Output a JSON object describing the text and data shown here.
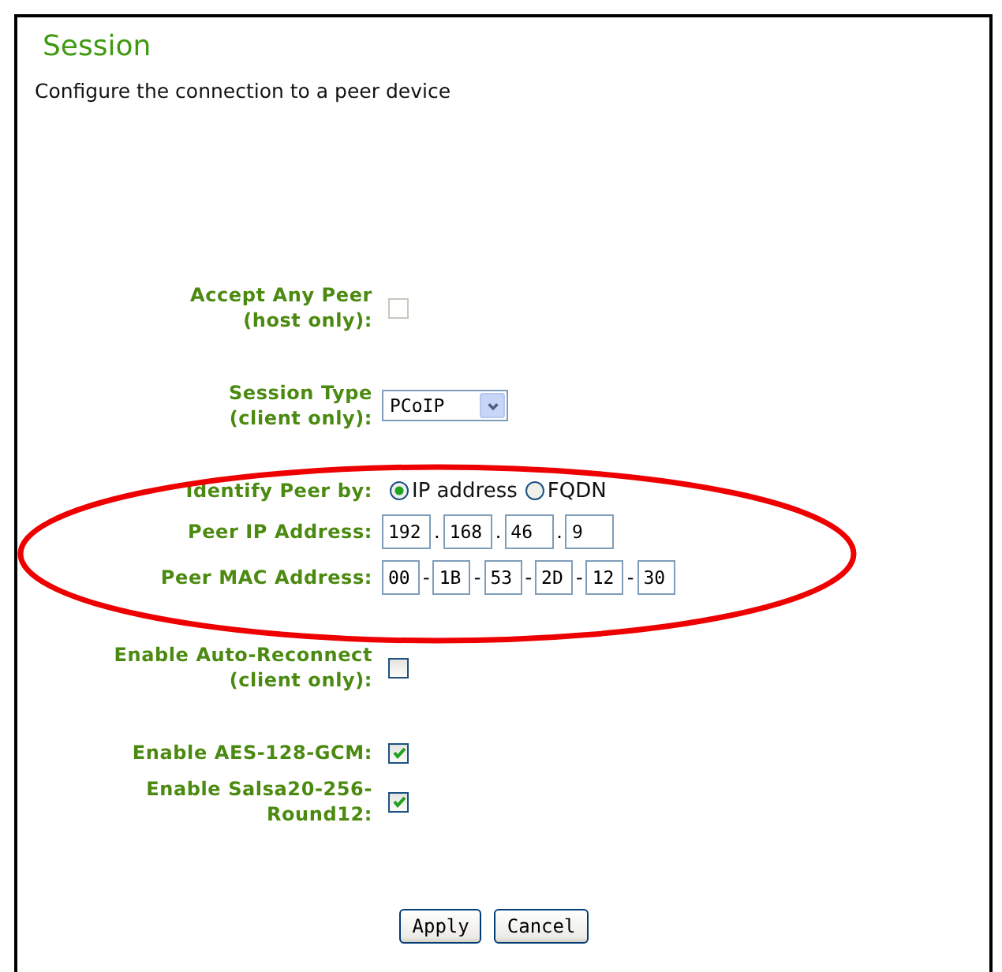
{
  "title": "Session",
  "description": "Configure the connection to a peer device",
  "groups": [
    {
      "rows": [
        {
          "kind": "checkbox",
          "label": [
            "Accept Any Peer",
            "(host only):"
          ],
          "checked": false,
          "disabled": true
        }
      ]
    },
    {
      "rows": [
        {
          "kind": "select",
          "label": [
            "Session Type",
            "(client only):"
          ],
          "value": "PCoIP"
        }
      ]
    },
    {
      "rows": [
        {
          "kind": "radio",
          "label": [
            "Identify Peer by:"
          ],
          "options": [
            {
              "label": "IP address",
              "selected": true
            },
            {
              "label": "FQDN",
              "selected": false
            }
          ]
        },
        {
          "kind": "ip",
          "label": [
            "Peer IP Address:"
          ],
          "separator": ".",
          "parts": [
            "192",
            "168",
            "46",
            "9"
          ]
        },
        {
          "kind": "mac",
          "label": [
            "Peer MAC Address:"
          ],
          "separator": "-",
          "parts": [
            "00",
            "1B",
            "53",
            "2D",
            "12",
            "30"
          ]
        }
      ]
    },
    {
      "rows": [
        {
          "kind": "checkbox",
          "label": [
            "Enable Auto-Reconnect",
            "(client only):"
          ],
          "checked": false,
          "disabled": false
        }
      ]
    },
    {
      "rows": [
        {
          "kind": "checkbox",
          "label": [
            "Enable AES-128-GCM:"
          ],
          "checked": true,
          "disabled": false
        },
        {
          "kind": "checkbox",
          "label": [
            "Enable Salsa20-256-",
            "Round12:"
          ],
          "checked": true,
          "disabled": false
        }
      ]
    }
  ],
  "buttons": [
    "Apply",
    "Cancel"
  ]
}
